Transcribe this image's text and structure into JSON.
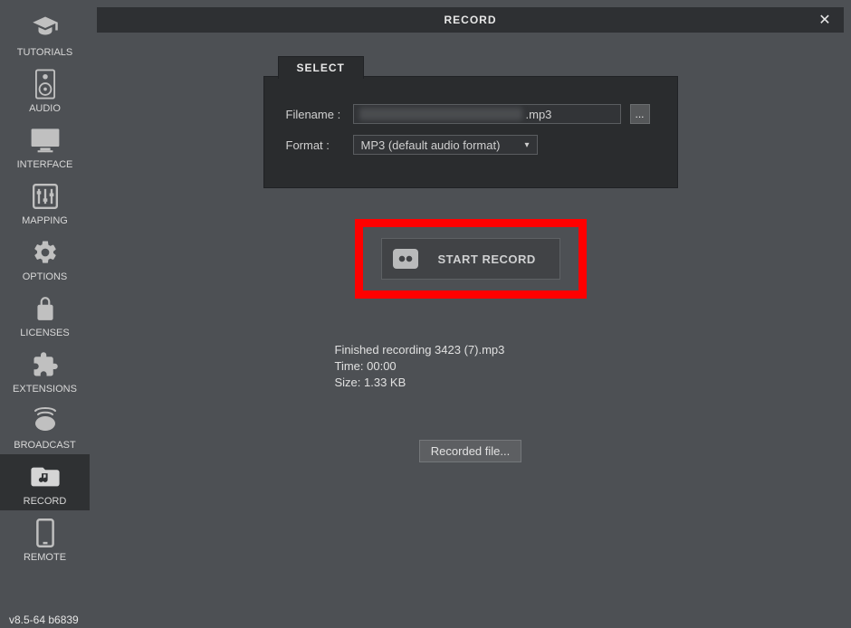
{
  "sidebar": {
    "items": [
      {
        "id": "tutorials",
        "label": "TUTORIALS",
        "active": false
      },
      {
        "id": "audio",
        "label": "AUDIO",
        "active": false
      },
      {
        "id": "interface",
        "label": "INTERFACE",
        "active": false
      },
      {
        "id": "mapping",
        "label": "MAPPING",
        "active": false
      },
      {
        "id": "options",
        "label": "OPTIONS",
        "active": false
      },
      {
        "id": "licenses",
        "label": "LICENSES",
        "active": false
      },
      {
        "id": "extensions",
        "label": "EXTENSIONS",
        "active": false
      },
      {
        "id": "broadcast",
        "label": "BROADCAST",
        "active": false
      },
      {
        "id": "record",
        "label": "RECORD",
        "active": true
      },
      {
        "id": "remote",
        "label": "REMOTE",
        "active": false
      }
    ],
    "version": "v8.5-64 b6839"
  },
  "header": {
    "title": "RECORD",
    "close": "✕"
  },
  "panel": {
    "tab_label": "SELECT",
    "filename_label": "Filename :",
    "filename_ext": ".mp3",
    "browse_label": "...",
    "format_label": "Format :",
    "format_value": "MP3 (default audio format)"
  },
  "start_button": {
    "label": "START RECORD"
  },
  "status": {
    "line1": "Finished recording 3423 (7).mp3",
    "line2": "Time: 00:00",
    "line3": "Size: 1.33 KB"
  },
  "recorded_button": {
    "label": "Recorded file..."
  }
}
